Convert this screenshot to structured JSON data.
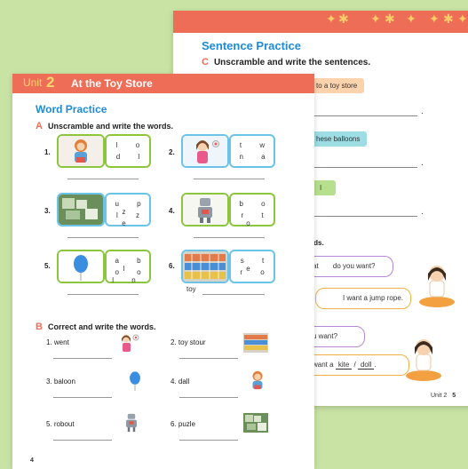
{
  "back_page": {
    "section_title": "Sentence Practice",
    "section_c": {
      "letter": "C",
      "instruction": "Unscramble and write the sentences."
    },
    "chips": [
      "to a toy store",
      "hese balloons",
      "I"
    ],
    "section_d_fragment": "rds.",
    "dialog": [
      {
        "parts": [
          "at",
          "do you want?"
        ]
      },
      {
        "parts": [
          "I want a jump rope."
        ]
      },
      {
        "parts": [
          "u want?"
        ]
      },
      {
        "parts": [
          "want a",
          "kite",
          "/",
          "doll",
          "."
        ]
      }
    ],
    "page_footer": {
      "unit_label": "Unit 2",
      "page_number": "5"
    }
  },
  "front_page": {
    "unit_label": "Unit",
    "unit_number": "2",
    "unit_title": "At the Toy Store",
    "section_title": "Word Practice",
    "section_a": {
      "letter": "A",
      "instruction": "Unscramble and write the words.",
      "items": [
        {
          "number": "1.",
          "picture": "doll-icon",
          "row1": "l o",
          "row2": "d l"
        },
        {
          "number": "2.",
          "picture": "girl-wanting-icon",
          "row1": "t w",
          "row2": "n a"
        },
        {
          "number": "3.",
          "picture": "puzzle-icon",
          "row1": "u p z",
          "row2": "l z e"
        },
        {
          "number": "4.",
          "picture": "robot-icon",
          "row1": "b o",
          "row2": "r t o"
        },
        {
          "number": "5.",
          "picture": "balloon-icon",
          "row1": "a b l",
          "row2": "o o l n"
        },
        {
          "number": "6.",
          "picture": "store-shelf-icon",
          "row1": "s t e",
          "row2": "r o"
        }
      ],
      "prefix_word": "toy"
    },
    "section_b": {
      "letter": "B",
      "instruction": "Correct and write the words.",
      "items": [
        {
          "label": "1. went",
          "picture": "girl-wanting-icon"
        },
        {
          "label": "2. toy stour",
          "picture": "store-shelf-icon"
        },
        {
          "label": "3. baloon",
          "picture": "balloon-icon"
        },
        {
          "label": "4. dall",
          "picture": "doll-icon"
        },
        {
          "label": "5. robout",
          "picture": "robot-icon"
        },
        {
          "label": "6. puzle",
          "picture": "puzzle-icon"
        }
      ]
    },
    "page_number": "4"
  },
  "colors": {
    "background": "#c9e3a5",
    "header_band": "#ee6d57",
    "title_blue": "#1f8bd6",
    "accent_yellow": "#ffd66a",
    "green_border": "#8cc63f",
    "blue_border": "#6cc3e8",
    "chip_orange": "#fcd3ad",
    "chip_teal": "#9ddde4",
    "chip_green": "#b6e08e"
  }
}
